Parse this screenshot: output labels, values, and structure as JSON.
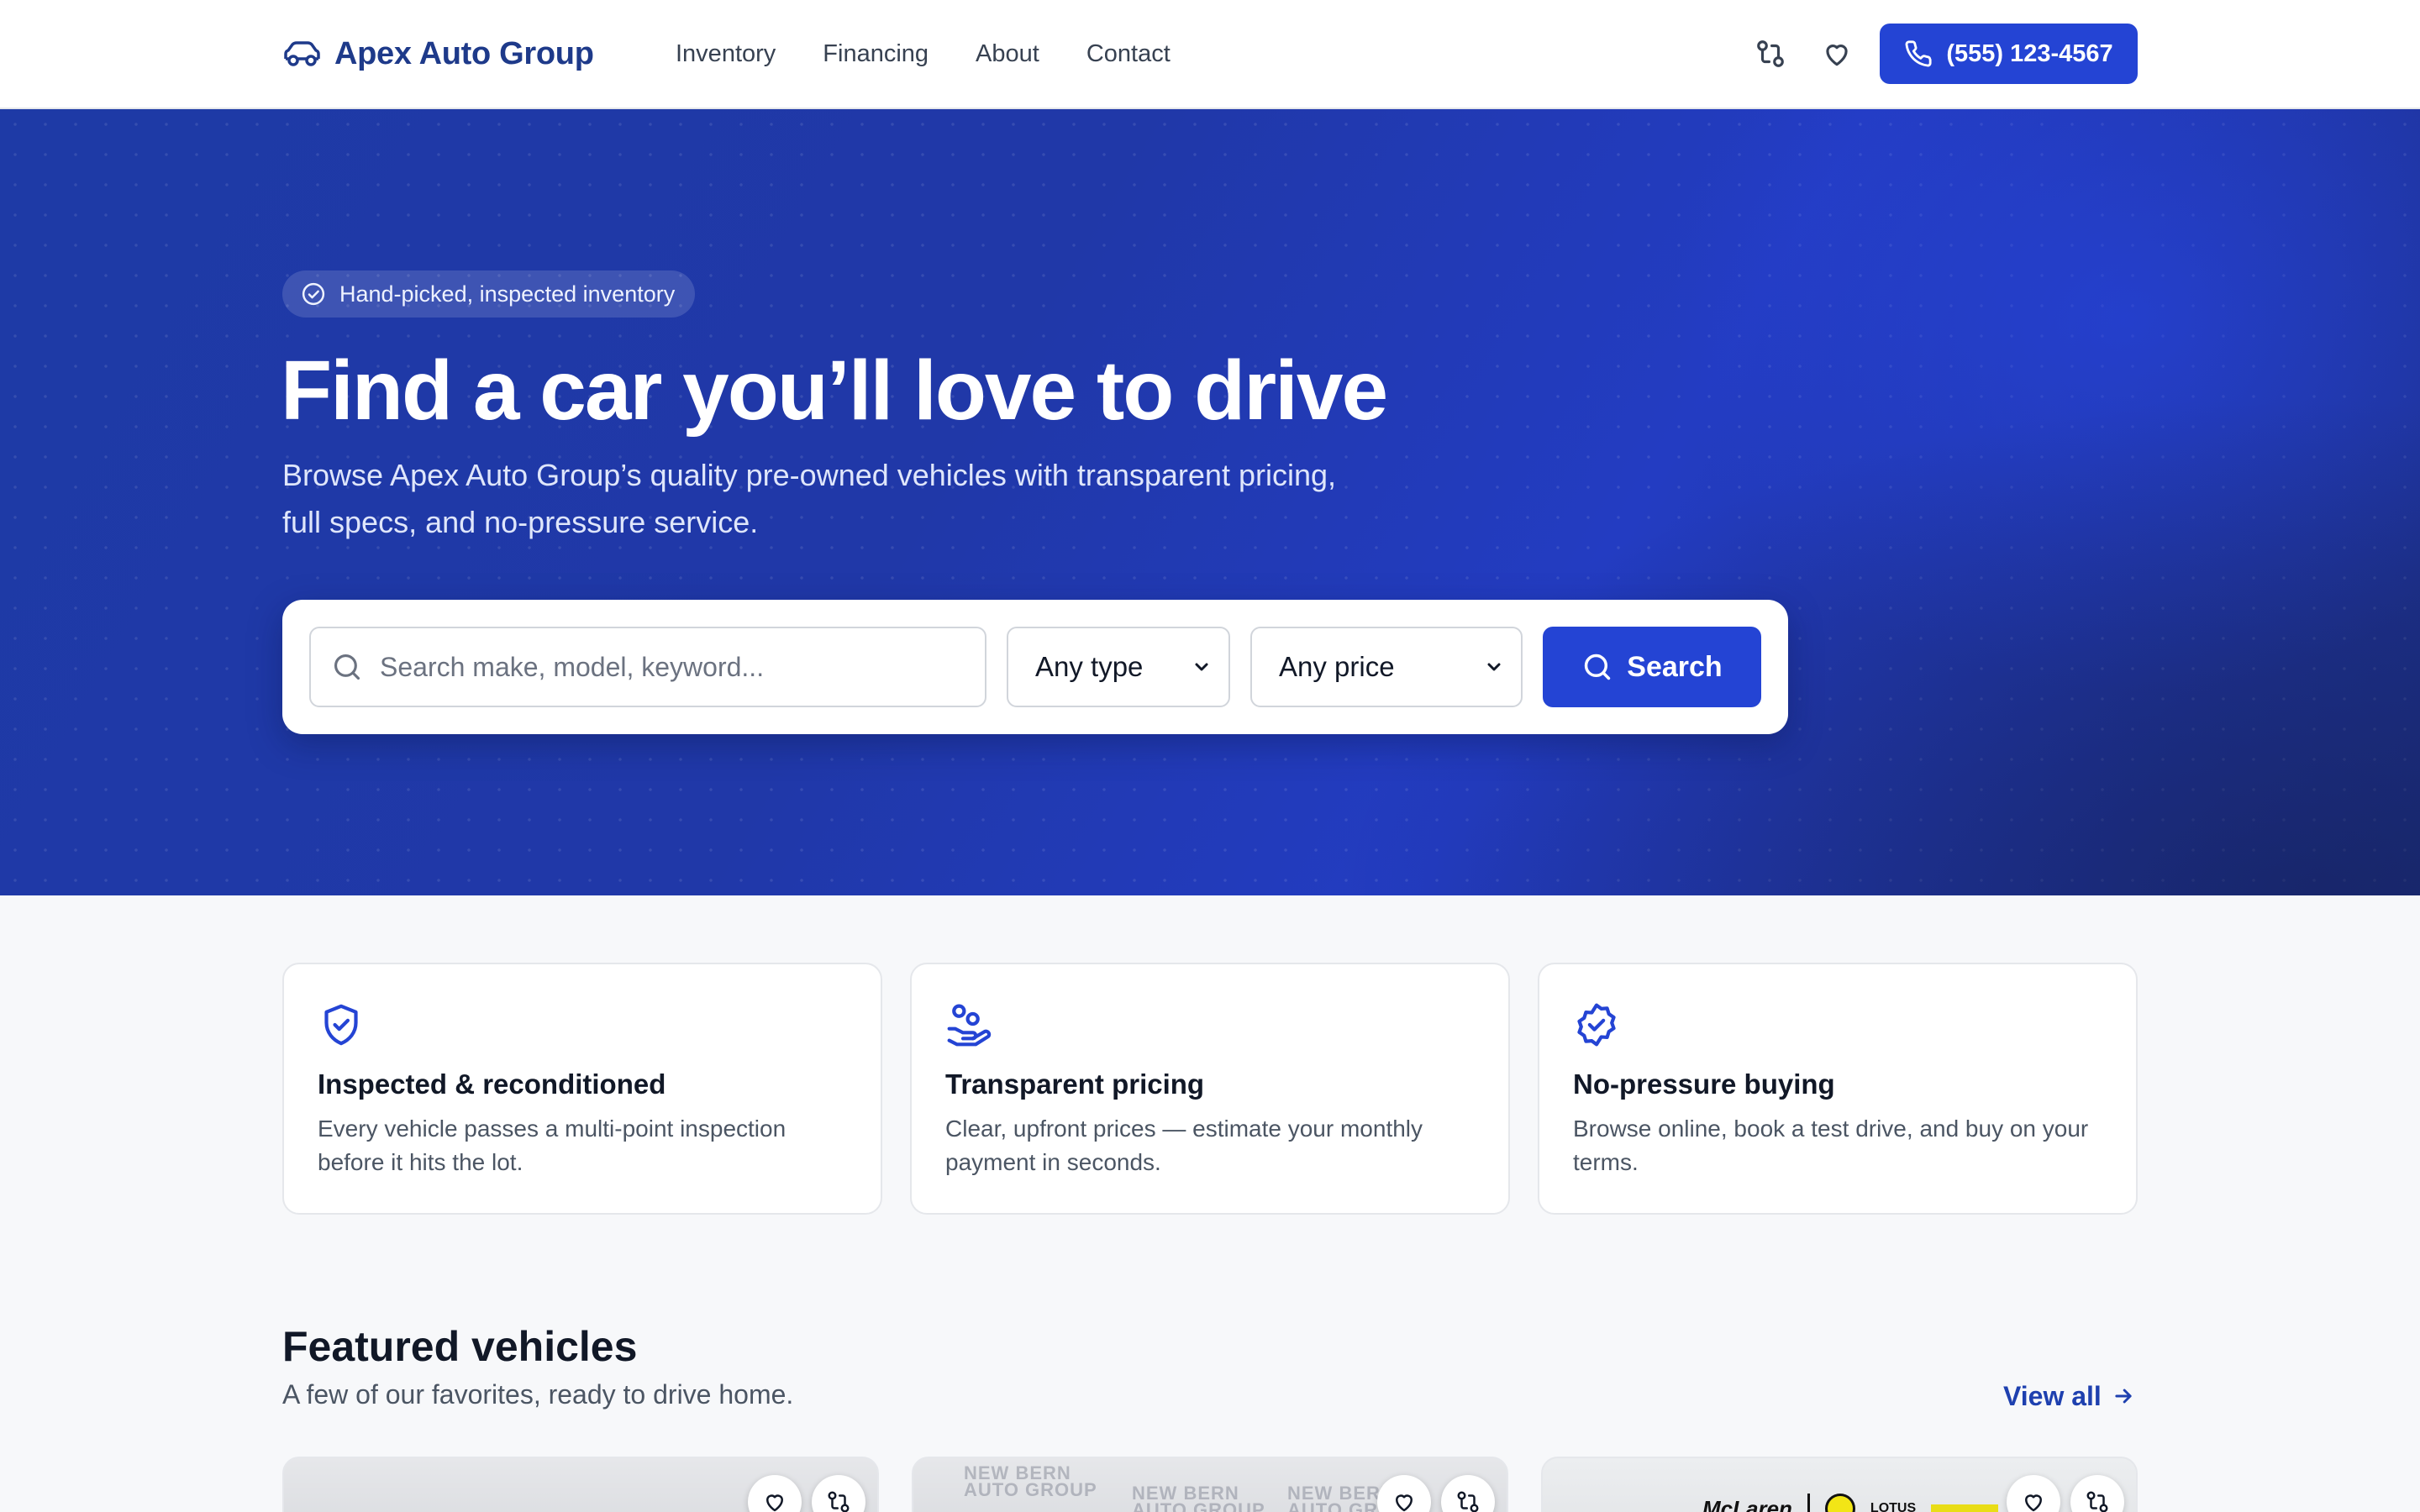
{
  "header": {
    "brand": "Apex Auto Group",
    "nav": [
      "Inventory",
      "Financing",
      "About",
      "Contact"
    ],
    "phone": "(555) 123-4567",
    "icons": {
      "logo": "car-icon",
      "compare": "compare-icon",
      "favorites": "heart-icon",
      "phone": "phone-icon"
    }
  },
  "hero": {
    "badge": "Hand-picked, inspected inventory",
    "title": "Find a car you’ll love to drive",
    "subtitle": "Browse Apex Auto Group’s quality pre-owned vehicles with transparent pricing, full specs, and no-pressure service.",
    "search": {
      "placeholder": "Search make, model, keyword...",
      "type_value": "Any type",
      "price_value": "Any price",
      "button": "Search"
    }
  },
  "features": [
    {
      "title": "Inspected & reconditioned",
      "text": "Every vehicle passes a multi-point inspection before it hits the lot.",
      "icon": "shield-check-icon"
    },
    {
      "title": "Transparent pricing",
      "text": "Clear, upfront prices — estimate your monthly payment in seconds.",
      "icon": "hand-coins-icon"
    },
    {
      "title": "No-pressure buying",
      "text": "Browse online, book a test drive, and buy on your terms.",
      "icon": "badge-check-icon"
    }
  ],
  "featured": {
    "title": "Featured vehicles",
    "subtitle": "A few of our favorites, ready to drive home.",
    "view_all": "View all",
    "cards": [
      {
        "watermark": []
      },
      {
        "watermark": [
          "NEW BERN",
          "AUTO GROUP"
        ]
      },
      {
        "logos": [
          "McLaren",
          "LOTUS"
        ]
      }
    ]
  },
  "colors": {
    "primary": "#2444d4",
    "brand_text": "#1e3a8a",
    "hero_bg": "#2038a8"
  }
}
